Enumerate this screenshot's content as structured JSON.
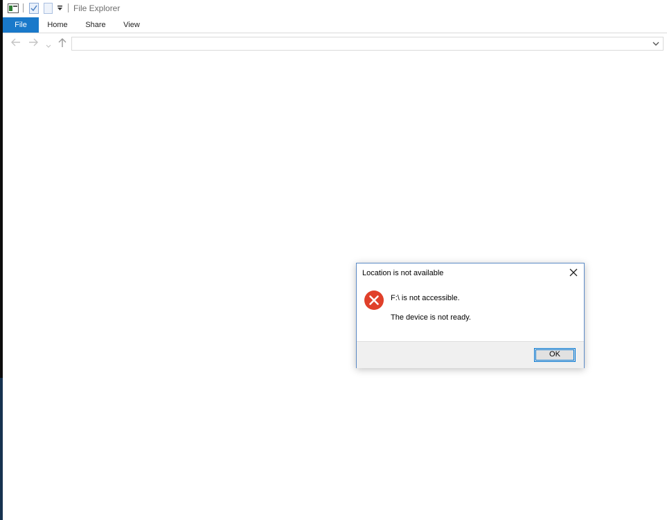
{
  "window": {
    "title": "File Explorer"
  },
  "ribbon": {
    "tabs": [
      "File",
      "Home",
      "Share",
      "View"
    ]
  },
  "address": {
    "value": ""
  },
  "dialog": {
    "title": "Location is not available",
    "message_primary": "F:\\ is not accessible.",
    "message_secondary": "The device is not ready.",
    "ok_label": "OK",
    "icon": "error-icon"
  },
  "colors": {
    "accent": "#1979ca",
    "error": "#e0402a",
    "dialog_border": "#5b8ac6"
  }
}
